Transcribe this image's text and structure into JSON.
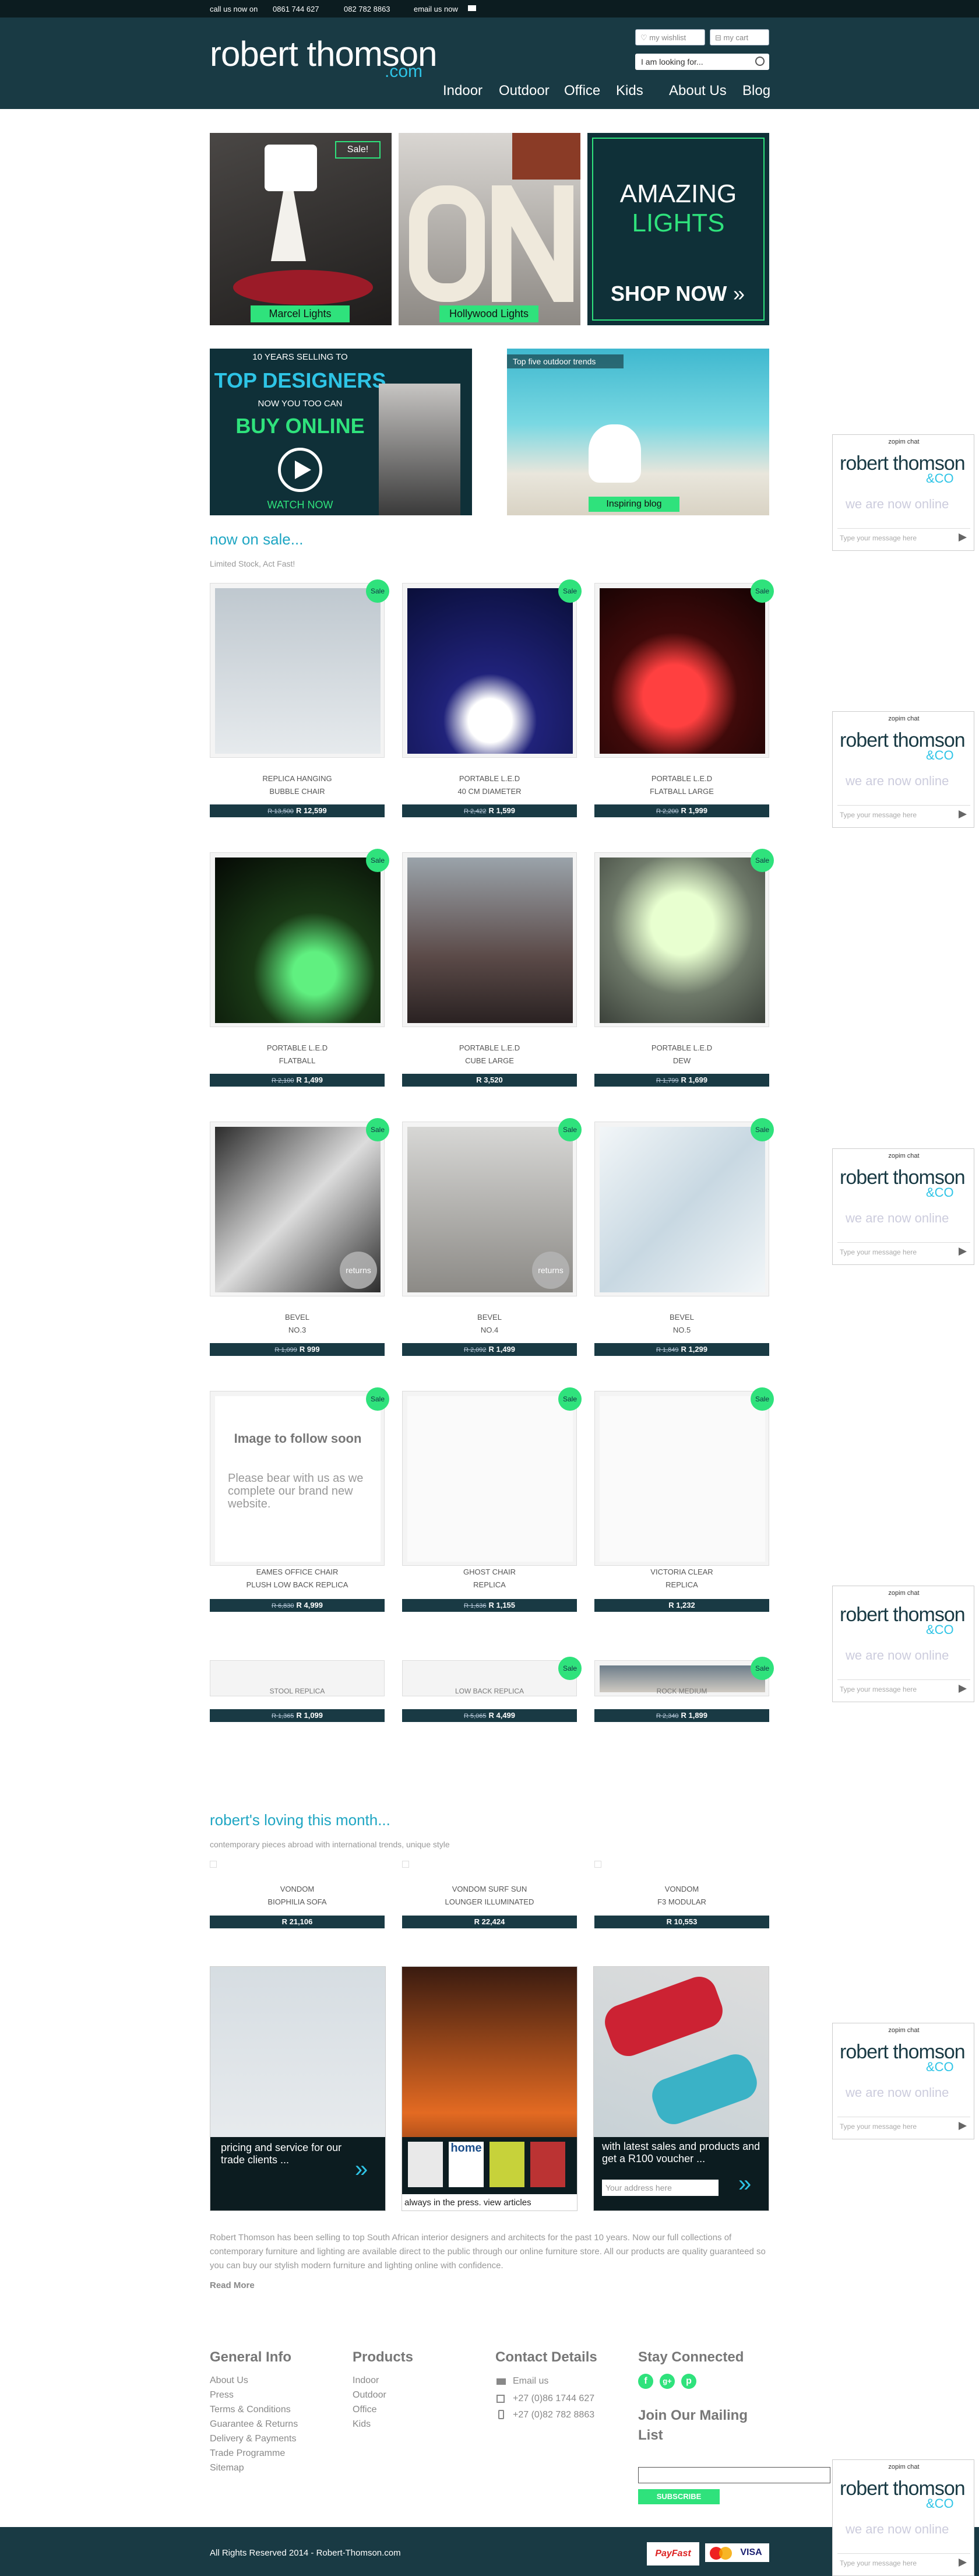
{
  "topbar": {
    "call_label": "call us now on",
    "phone1": "0861 744 627",
    "phone2": "082 782 8863",
    "email_label": "email us now"
  },
  "header": {
    "logo_main": "robert thomson",
    "logo_sub": ".com",
    "wishlist": "my wishlist",
    "cart": "my cart",
    "search_placeholder": "I am looking for..."
  },
  "nav": [
    "Indoor",
    "Outdoor",
    "Office",
    "Kids",
    "About Us",
    "Blog"
  ],
  "banners": {
    "marcel": "Marcel Lights",
    "sale": "Sale!",
    "hollywood": "Hollywood Lights",
    "amazing1": "AMAZING",
    "amazing2": "LIGHTS",
    "shop_now": "SHOP NOW",
    "designers1": "10 YEARS SELLING TO",
    "designers2": "TOP DESIGNERS",
    "designers3": "NOW YOU TOO CAN",
    "designers4": "BUY ONLINE",
    "watch": "WATCH NOW",
    "outdoor_trends": "Top five outdoor trends",
    "inspiring": "Inspiring blog"
  },
  "sale_section": {
    "title": "now on sale...",
    "subtitle": "Limited Stock, Act Fast!",
    "badge": "Sale"
  },
  "products": [
    {
      "name1": "REPLICA HANGING",
      "name2": "BUBBLE CHAIR",
      "old": "R 13,500",
      "price": "R 12,599"
    },
    {
      "name1": "PORTABLE L.E.D",
      "name2": "40 CM DIAMETER",
      "old": "R 2,422",
      "price": "R 1,599"
    },
    {
      "name1": "PORTABLE L.E.D",
      "name2": "FLATBALL LARGE",
      "old": "R 2,200",
      "price": "R 1,999"
    },
    {
      "name1": "PORTABLE L.E.D",
      "name2": "FLATBALL",
      "old": "R 2,100",
      "price": "R 1,499"
    },
    {
      "name1": "PORTABLE L.E.D",
      "name2": "CUBE LARGE",
      "old": "",
      "price": "R 3,520"
    },
    {
      "name1": "PORTABLE L.E.D",
      "name2": "DEW",
      "old": "R 1,799",
      "price": "R 1,699"
    },
    {
      "name1": "BEVEL",
      "name2": "NO.3",
      "old": "R 1,099",
      "price": "R 999"
    },
    {
      "name1": "BEVEL",
      "name2": "NO.4",
      "old": "R 2,092",
      "price": "R 1,499"
    },
    {
      "name1": "BEVEL",
      "name2": "NO.5",
      "old": "R 1,849",
      "price": "R 1,299"
    },
    {
      "name1": "EAMES OFFICE CHAIR",
      "name2": "PLUSH LOW BACK REPLICA",
      "old": "R 6,830",
      "price": "R 4,999"
    },
    {
      "name1": "GHOST CHAIR",
      "name2": "REPLICA",
      "old": "R 1,636",
      "price": "R 1,155"
    },
    {
      "name1": "VICTORIA CLEAR",
      "name2": "REPLICA",
      "old": "",
      "price": "R 1,232"
    },
    {
      "name1": "STOOL REPLICA",
      "name2": "",
      "old": "R 1,365",
      "price": "R 1,099"
    },
    {
      "name1": "LOW BACK REPLICA",
      "name2": "",
      "old": "R 5,065",
      "price": "R 4,499"
    },
    {
      "name1": "ROCK MEDIUM",
      "name2": "",
      "old": "R 2,340",
      "price": "R 1,899"
    }
  ],
  "placeholder": {
    "title": "Image to follow soon",
    "body": "Please bear with us as we complete our brand new website."
  },
  "returns_label": "returns",
  "loving": {
    "title": "robert's loving this month...",
    "subtitle": "contemporary pieces abroad with international trends, unique style",
    "items": [
      {
        "name1": "VONDOM",
        "name2": "BIOPHILIA SOFA",
        "price": "R 21,106"
      },
      {
        "name1": "VONDOM SURF SUN",
        "name2": "LOUNGER ILLUMINATED",
        "price": "R 22,424"
      },
      {
        "name1": "VONDOM",
        "name2": "F3 MODULAR",
        "price": "R 10,553"
      }
    ]
  },
  "promos": {
    "trade": "pricing and service for our trade clients ...",
    "press": "always in the press. view articles",
    "voucher": "with latest sales and products and get a R100 voucher ...",
    "address_placeholder": "Your address here",
    "press_mag": "home"
  },
  "about": {
    "text": "Robert Thomson has been selling to top South African interior designers and architects for the past 10 years. Now our full collections of contemporary furniture and lighting are available direct to the public through our online furniture store. All our products are quality guaranteed so you can buy our stylish modern furniture and lighting online with confidence.",
    "read_more": "Read More"
  },
  "footer": {
    "general_title": "General Info",
    "general_links": [
      "About Us",
      "Press",
      "Terms & Conditions",
      "Guarantee & Returns",
      "Delivery & Payments",
      "Trade Programme",
      "Sitemap"
    ],
    "products_title": "Products",
    "products_links": [
      "Indoor",
      "Outdoor",
      "Office",
      "Kids"
    ],
    "contact_title": "Contact Details",
    "contact_email": "Email us",
    "contact_phone1": "+27 (0)86 1744 627",
    "contact_phone2": "+27 (0)82 782 8863",
    "stay_title": "Stay Connected",
    "mailing_title": "Join Our Mailing List",
    "subscribe": "SUBSCRIBE",
    "copyright": "All Rights Reserved 2014 - Robert-Thomson.com"
  },
  "chat": {
    "brand": "zopim chat",
    "logo": "robert thomson",
    "logo_co": "&CO",
    "online": "we are now online",
    "placeholder": "Type your message here"
  },
  "payments": [
    "PayFast",
    "MasterCard",
    "VISA"
  ],
  "colors": {
    "header": "#193a44",
    "accent_green": "#2fe27c",
    "accent_blue": "#1fa6c3"
  }
}
